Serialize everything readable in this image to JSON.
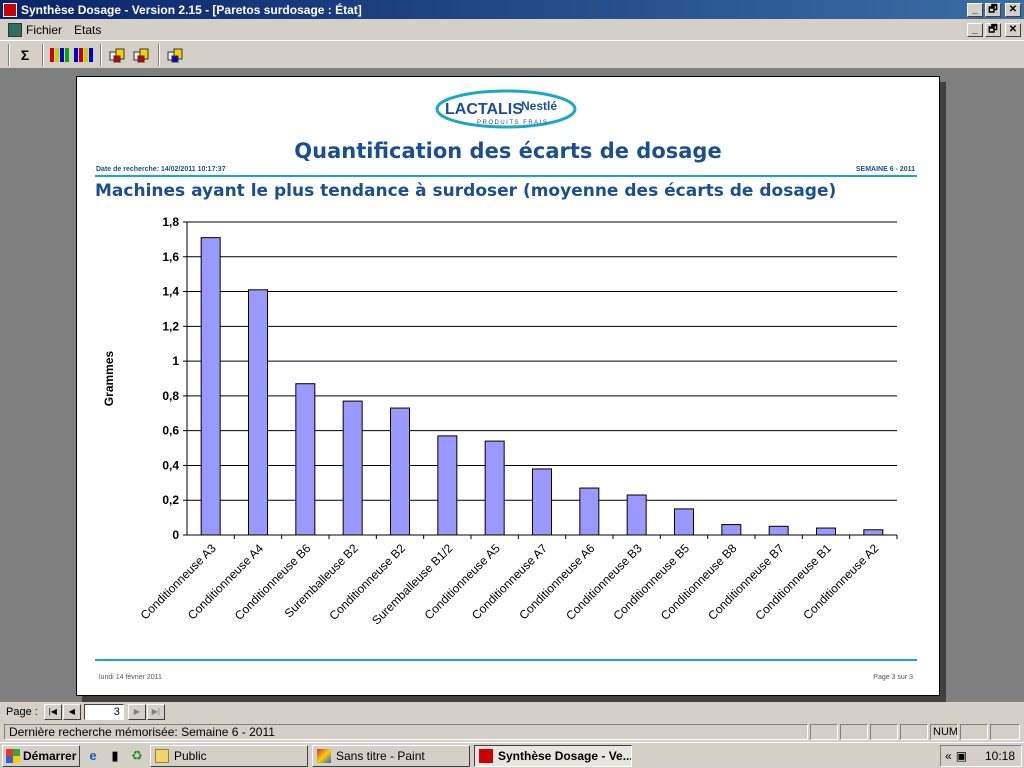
{
  "window": {
    "title": "Synthèse Dosage - Version 2.15 - [Paretos surdosage : État]",
    "minimize": "_",
    "restore": "🗗",
    "close": "✕"
  },
  "menu": {
    "items": [
      "Fichier",
      "Etats"
    ]
  },
  "toolbar": {
    "sigma": "Σ"
  },
  "report": {
    "logo_main": "LACTALIS",
    "logo_nestle": "Nestlé",
    "logo_sub": "PRODUITS FRAIS",
    "title": "Quantification des écarts de dosage",
    "search_date": "Date de recherche: 14/02/2011 10:17:37",
    "week": "SEMAINE 6 - 2011",
    "subtitle": "Machines ayant le plus tendance à surdoser (moyenne des écarts de dosage)",
    "footer_date": "lundi 14 février 2011",
    "footer_page": "Page 3 sur 3"
  },
  "chart_data": {
    "type": "bar",
    "categories": [
      "Conditionneuse A3",
      "Conditionneuse A4",
      "Conditionneuse B6",
      "Suremballeuse B2",
      "Conditionneuse B2",
      "Suremballeuse B1/2",
      "Conditionneuse A5",
      "Conditionneuse A7",
      "Conditionneuse A6",
      "Conditionneuse B3",
      "Conditionneuse B5",
      "Conditionneuse B8",
      "Conditionneuse B7",
      "Conditionneuse B1",
      "Conditionneuse A2"
    ],
    "values": [
      1.71,
      1.41,
      0.87,
      0.77,
      0.73,
      0.57,
      0.54,
      0.38,
      0.27,
      0.23,
      0.15,
      0.06,
      0.05,
      0.04,
      0.03
    ],
    "title": "",
    "xlabel": "",
    "ylabel": "Grammes",
    "ylim": [
      0,
      1.8
    ],
    "yticks": [
      "0",
      "0,2",
      "0,4",
      "0,6",
      "0,8",
      "1",
      "1,2",
      "1,4",
      "1,6",
      "1,8"
    ],
    "grid": true,
    "bar_color": "#9999ff"
  },
  "pagenav": {
    "label": "Page :",
    "first": "|◀",
    "prev": "◀",
    "current": "3",
    "next": "▶",
    "last": "▶|"
  },
  "status": {
    "text": "Dernière recherche mémorisée: Semaine 6 - 2011",
    "num": "NUM"
  },
  "taskbar": {
    "start": "Démarrer",
    "tasks": [
      "Public",
      "Sans titre - Paint",
      "Synthèse Dosage - Ve..."
    ],
    "clock": "10:18",
    "tray_chevron": "«"
  }
}
